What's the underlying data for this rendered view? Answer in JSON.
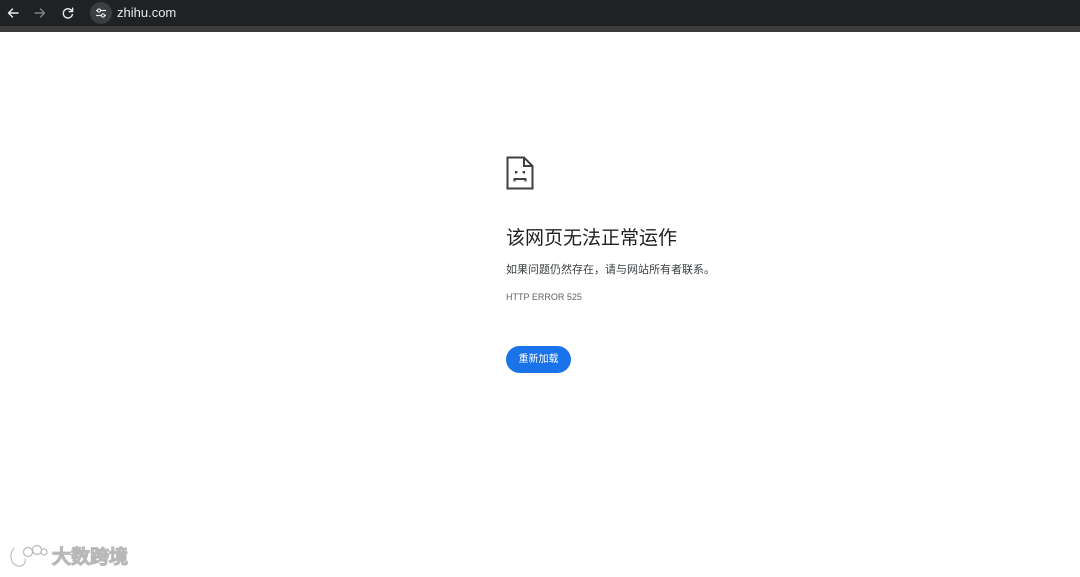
{
  "browser": {
    "url": "zhihu.com",
    "back_icon": "arrow-left-icon",
    "forward_icon": "arrow-right-icon",
    "reload_icon": "reload-icon",
    "site_info_icon": "tune-icon",
    "toolbar_color": "#202124"
  },
  "error_page": {
    "icon": "sad-page-icon",
    "heading": "该网页无法正常运作",
    "message": "如果问题仍然存在，请与网站所有者联系。",
    "error_code": "HTTP ERROR 525",
    "reload_button": "重新加载",
    "accent_color": "#1a73e8"
  },
  "watermark": {
    "logo": "dashu-logo-icon",
    "text": "大数跨境"
  }
}
